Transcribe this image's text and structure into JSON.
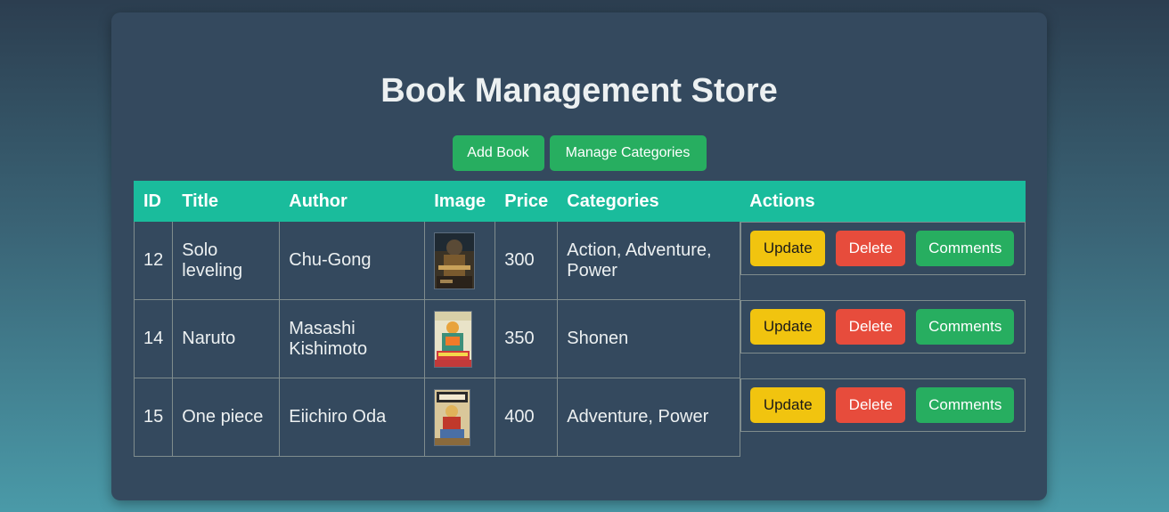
{
  "page": {
    "title": "Book Management Store"
  },
  "toolbar": {
    "add_book_label": "Add Book",
    "manage_categories_label": "Manage Categories"
  },
  "table": {
    "headers": [
      "ID",
      "Title",
      "Author",
      "Image",
      "Price",
      "Categories",
      "Actions"
    ],
    "rows": [
      {
        "id": "12",
        "title": "Solo leveling",
        "author": "Chu-Gong",
        "image": "solo-leveling-cover",
        "price": "300",
        "categories": "Action, Adventure, Power"
      },
      {
        "id": "14",
        "title": "Naruto",
        "author": "Masashi Kishimoto",
        "image": "naruto-cover",
        "price": "350",
        "categories": "Shonen"
      },
      {
        "id": "15",
        "title": "One piece",
        "author": "Eiichiro Oda",
        "image": "one-piece-cover",
        "price": "400",
        "categories": "Adventure, Power"
      }
    ],
    "actions": {
      "update_label": "Update",
      "delete_label": "Delete",
      "comments_label": "Comments"
    }
  },
  "colors": {
    "card_bg": "#34495e",
    "header_bg": "#1abc9c",
    "green": "#27ae60",
    "yellow": "#f1c40f",
    "red": "#e74c3c"
  }
}
